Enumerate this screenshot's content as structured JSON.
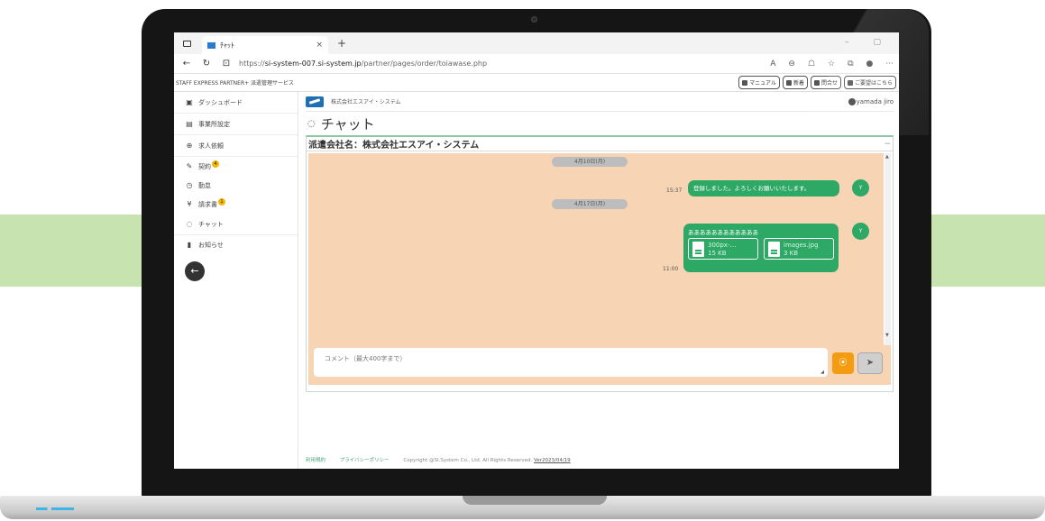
{
  "browser": {
    "tab_title": "ﾁｬｯﾄ",
    "tab_close": "×",
    "new_tab": "+",
    "url_prefix": "https://",
    "url_host": "si-system-007.si-system.jp",
    "url_path": "/partner/pages/order/toiawase.php",
    "window_controls": "– ▢"
  },
  "site": {
    "brand": "STAFF EXPRESS PARTNER+ 派遣管理サービス",
    "header_buttons": [
      "マニュアル",
      "新着",
      "問合せ",
      "ご要望はこちら"
    ]
  },
  "sidebar": {
    "items": [
      {
        "label": "ダッシュボード",
        "icon": "dashboard-icon",
        "glyph": "▣"
      },
      {
        "label": "事業所設定",
        "icon": "building-icon",
        "glyph": "▤"
      },
      {
        "label": "求人依頼",
        "icon": "search-person-icon",
        "glyph": "⊕"
      },
      {
        "label": "契約",
        "icon": "pen-icon",
        "glyph": "✎",
        "badge": "4"
      },
      {
        "label": "勤怠",
        "icon": "clock-icon",
        "glyph": "◷"
      },
      {
        "label": "請求書",
        "icon": "yen-icon",
        "glyph": "¥",
        "badge": "1"
      },
      {
        "label": "チャット",
        "icon": "chat-icon",
        "glyph": "◌"
      },
      {
        "label": "お知らせ",
        "icon": "notice-icon",
        "glyph": "▮"
      }
    ],
    "back_glyph": "←"
  },
  "header": {
    "company": "株式会社エスアイ・システム",
    "user": "yamada jiro"
  },
  "page": {
    "title": "チャット"
  },
  "panel": {
    "heading": "派遣会社名：株式会社エスアイ・システム",
    "minimize": "−"
  },
  "chat": {
    "date1": "4月10日(月)",
    "time1": "15:37",
    "msg1": "登録しました。よろしくお願いいたします。",
    "avatar1": "Y",
    "date2": "4月17日(月)",
    "time2": "11:00",
    "msg2": "ああああああああああああ",
    "avatar2": "Y",
    "files": [
      {
        "name": "300px-…",
        "size": "15 KB"
      },
      {
        "name": "images.jpg",
        "size": "3 KB"
      }
    ]
  },
  "composer": {
    "placeholder": "コメント（最大400字まで）",
    "attach_glyph": "⦿",
    "send_glyph": "➤"
  },
  "footer": {
    "terms": "利用規約",
    "privacy": "プライバシーポリシー",
    "copyright": "Copyright @SI.System Co., Ltd. All Rights Reserved.",
    "version": "Ver2023/04/19"
  }
}
